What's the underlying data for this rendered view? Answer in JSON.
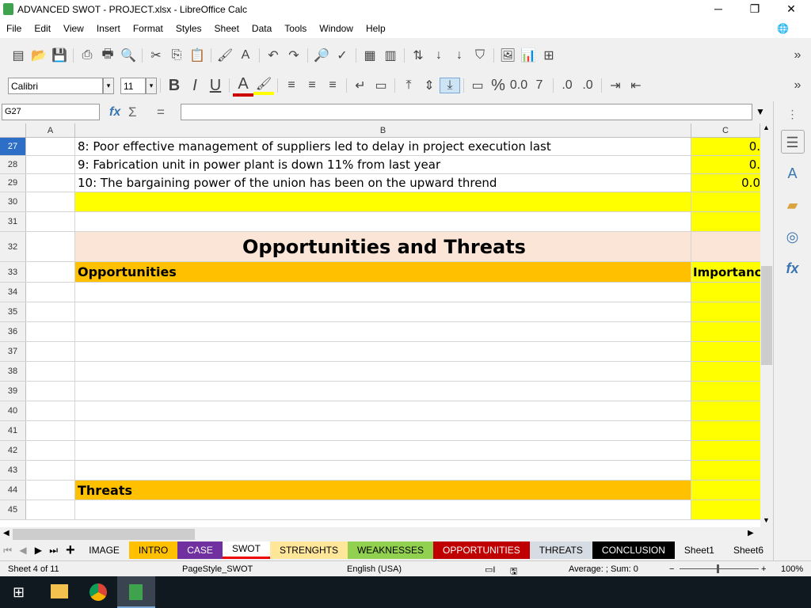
{
  "window": {
    "title": "ADVANCED SWOT - PROJECT.xlsx - LibreOffice Calc",
    "min": "─",
    "max": "❐",
    "close": "✕"
  },
  "menu": [
    "File",
    "Edit",
    "View",
    "Insert",
    "Format",
    "Styles",
    "Sheet",
    "Data",
    "Tools",
    "Window",
    "Help"
  ],
  "format": {
    "font": "Calibri",
    "size": "11"
  },
  "formula": {
    "cell_ref": "G27",
    "value": ""
  },
  "columns": [
    "A",
    "B",
    "C"
  ],
  "rows": [
    {
      "n": "27",
      "b": "8: Poor effective management of suppliers led to delay in project execution last",
      "c": "0."
    },
    {
      "n": "28",
      "b": "9: Fabrication unit in power plant is down 11% from last year",
      "c": "0."
    },
    {
      "n": "29",
      "b": "10: The bargaining power of the union has been on the upward thrend",
      "c": "0.0"
    },
    {
      "n": "30",
      "b": "",
      "c": ""
    },
    {
      "n": "31",
      "b": "",
      "c": ""
    },
    {
      "n": "32",
      "b": "Opportunities and Threats",
      "c": ""
    },
    {
      "n": "33",
      "b": "Opportunities",
      "c": "Importance"
    },
    {
      "n": "34"
    },
    {
      "n": "35"
    },
    {
      "n": "36"
    },
    {
      "n": "37"
    },
    {
      "n": "38"
    },
    {
      "n": "39"
    },
    {
      "n": "40"
    },
    {
      "n": "41"
    },
    {
      "n": "42"
    },
    {
      "n": "43"
    },
    {
      "n": "44",
      "b": "Threats",
      "c": ""
    },
    {
      "n": "45"
    }
  ],
  "tabs": [
    {
      "label": "IMAGE",
      "bg": "#f0f0f0",
      "fg": "#000"
    },
    {
      "label": "INTRO",
      "bg": "#ffc000",
      "fg": "#000"
    },
    {
      "label": "CASE",
      "bg": "#7030a0",
      "fg": "#fff"
    },
    {
      "label": "SWOT",
      "bg": "#ffffff",
      "fg": "#000"
    },
    {
      "label": "STRENGHTS",
      "bg": "#ffe699",
      "fg": "#000"
    },
    {
      "label": "WEAKNESSES",
      "bg": "#92d050",
      "fg": "#000"
    },
    {
      "label": "OPPORTUNITIES",
      "bg": "#c00000",
      "fg": "#fff"
    },
    {
      "label": "THREATS",
      "bg": "#d6dce4",
      "fg": "#000"
    },
    {
      "label": "CONCLUSION",
      "bg": "#000000",
      "fg": "#fff"
    },
    {
      "label": "Sheet1",
      "bg": "#f0f0f0",
      "fg": "#000"
    },
    {
      "label": "Sheet6",
      "bg": "#f0f0f0",
      "fg": "#000"
    }
  ],
  "status": {
    "sheet": "Sheet 4 of 11",
    "pagestyle": "PageStyle_SWOT",
    "lang": "English (USA)",
    "sum": "Average: ; Sum: 0",
    "zoom": "100%"
  }
}
